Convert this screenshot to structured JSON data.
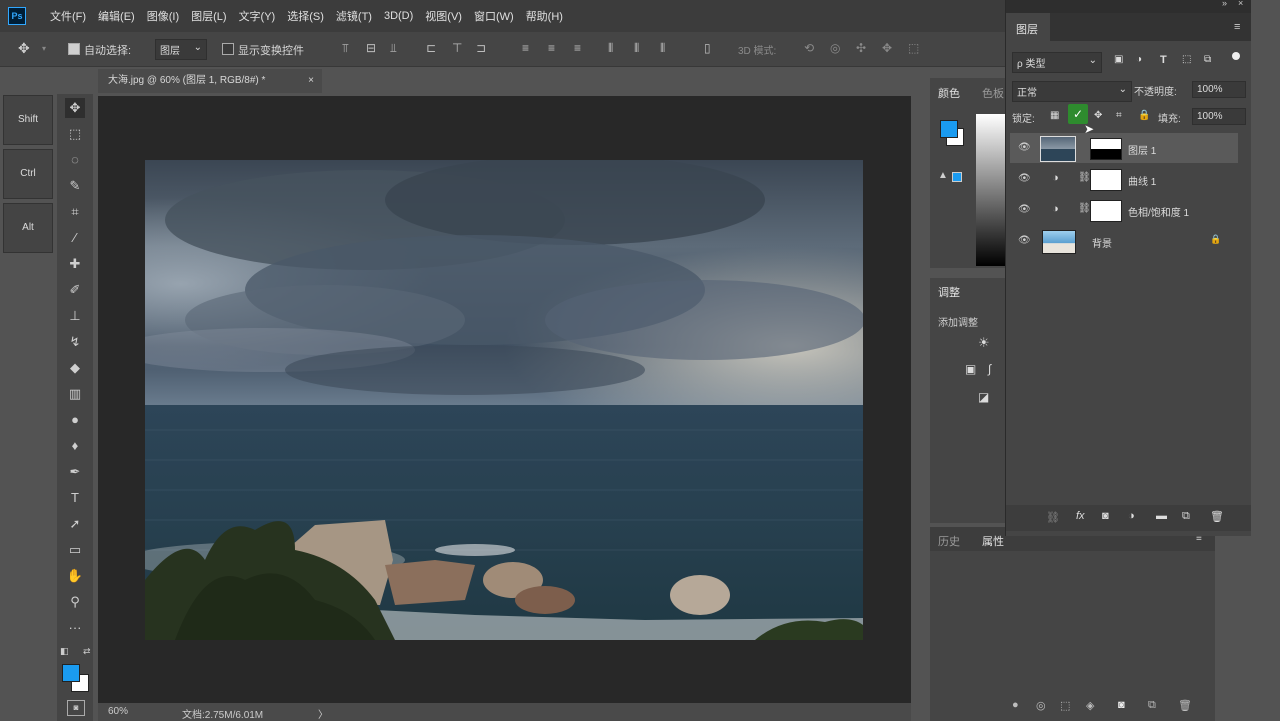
{
  "app": {
    "logo": "Ps"
  },
  "menu": [
    "文件(F)",
    "编辑(E)",
    "图像(I)",
    "图层(L)",
    "文字(Y)",
    "选择(S)",
    "滤镜(T)",
    "3D(D)",
    "视图(V)",
    "窗口(W)",
    "帮助(H)"
  ],
  "options": {
    "auto_select_label": "自动选择:",
    "auto_select_value": "图层",
    "show_transform_label": "显示变换控件",
    "mode_3d_label": "3D 模式:"
  },
  "shortcuts": [
    "Shift",
    "Ctrl",
    "Alt"
  ],
  "document": {
    "tab_title": "大海.jpg @ 60% (图层 1, RGB/8#) *",
    "tab_close": "×",
    "zoom": "60%",
    "doc_info": "文档:2.75M/6.01M",
    "status_arrow": "〉"
  },
  "panels": {
    "color_tab": "颜色",
    "swatches_tab": "色板",
    "adjustments_tab": "调整",
    "add_adjustment": "添加调整",
    "history_tab": "历史",
    "properties_tab": "属性"
  },
  "layers": {
    "tab": "图层",
    "filter_kind": "ρ 类型",
    "blend_mode": "正常",
    "opacity_label": "不透明度:",
    "opacity_value": "100%",
    "lock_label": "锁定:",
    "fill_label": "填充:",
    "fill_value": "100%",
    "items": [
      {
        "name": "图层 1",
        "type": "pixel-with-mask",
        "selected": true
      },
      {
        "name": "曲线 1",
        "type": "adjustment"
      },
      {
        "name": "色相/饱和度 1",
        "type": "adjustment"
      },
      {
        "name": "背景",
        "type": "background",
        "locked": true
      }
    ]
  },
  "colors": {
    "accent": "#31a8ff",
    "foreground": "#1a9bf0",
    "background_swatch": "#ffffff",
    "lock_highlight": "#2e8b2e"
  }
}
